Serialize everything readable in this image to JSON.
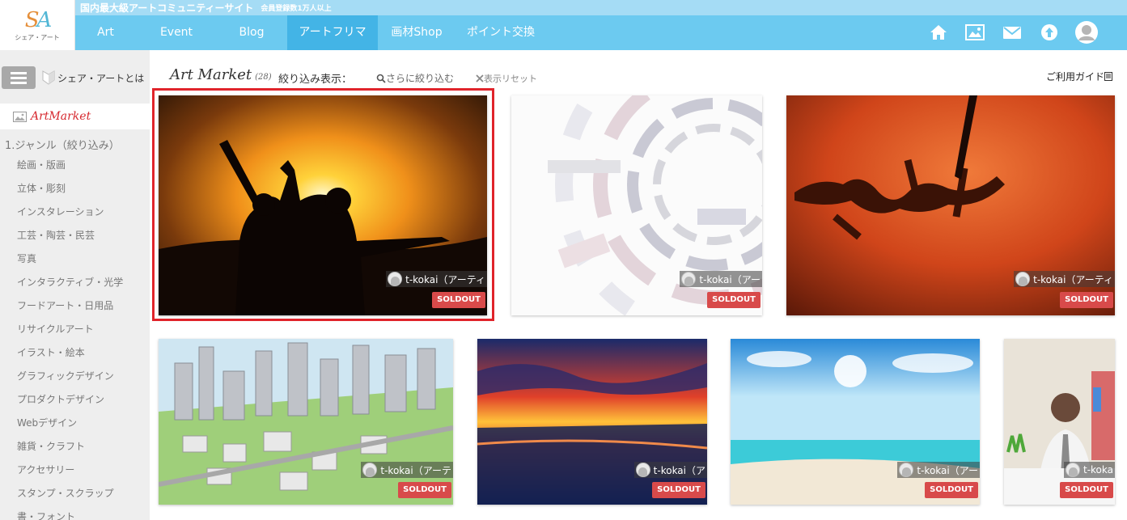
{
  "site": {
    "logo_text": "SA",
    "logo_sub": "シェア・アート",
    "tagline": "国内最大級アートコミュニティーサイト",
    "tagline_sub": "会員登録数1万人以上"
  },
  "nav": {
    "items": [
      {
        "label": "Art"
      },
      {
        "label": "Event"
      },
      {
        "label": "Blog"
      },
      {
        "label": "アートフリマ",
        "active": true
      },
      {
        "label": "画材Shop"
      },
      {
        "label": "ポイント交換"
      }
    ],
    "icons": [
      "home-icon",
      "gallery-icon",
      "mail-icon",
      "upload-icon",
      "user-avatar"
    ]
  },
  "sidebar": {
    "about": "シェア・アートとは",
    "active_label": "ArtMarket",
    "genre_title": "1.ジャンル（絞り込み）",
    "genres": [
      "絵画・版画",
      "立体・彫刻",
      "インスタレーション",
      "工芸・陶芸・民芸",
      "写真",
      "インタラクティブ・光学",
      "フードアート・日用品",
      "リサイクルアート",
      "イラスト・絵本",
      "グラフィックデザイン",
      "プロダクトデザイン",
      "Webデザイン",
      "雑貨・クラフト",
      "アクセサリー",
      "スタンプ・スクラップ",
      "書・フォント"
    ]
  },
  "main": {
    "title": "Art Market",
    "count": "(28)",
    "filter_label": "絞り込み表示：",
    "filter_more": "さらに絞り込む",
    "filter_reset": "表示リセット",
    "guide": "ご利用ガイド"
  },
  "colors": {
    "nav_bg": "#6ccaf0",
    "nav_active": "#43b4e6",
    "top_strip": "#a5dcf5",
    "sold_badge": "#d84a4a",
    "highlight": "#e0242b",
    "active_sidebar_text": "#d6292f"
  },
  "cards": [
    {
      "author": "t-kokai（アーティ",
      "badge": "SOLDOUT",
      "art": "sunset-silhouette-photo"
    },
    {
      "author": "t-kokai（アー",
      "badge": "SOLDOUT",
      "art": "abstract-tech-circle"
    },
    {
      "author": "t-kokai（アーティ",
      "badge": "SOLDOUT",
      "art": "calligraphy-red"
    },
    {
      "author": "t-kokai（アーテ",
      "badge": "SOLDOUT",
      "art": "isometric-city"
    },
    {
      "author": "t-kokai（ア",
      "badge": "SOLDOUT",
      "art": "sunset-sea-painting"
    },
    {
      "author": "t-kokai（アー",
      "badge": "SOLDOUT",
      "art": "tropical-beach"
    },
    {
      "author": "t-koka",
      "badge": "SOLDOUT",
      "art": "office-portrait"
    }
  ]
}
